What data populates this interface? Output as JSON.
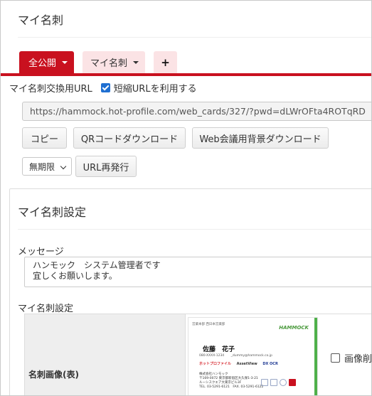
{
  "header": {
    "title": "マイ名刺"
  },
  "tabs": [
    {
      "label": "全公開",
      "has_dropdown": true,
      "active": true
    },
    {
      "label": "マイ名刺",
      "has_dropdown": true,
      "active": false
    },
    {
      "label": "+",
      "icon": "plus-icon"
    }
  ],
  "url_section": {
    "label": "マイ名刺交換用URL",
    "short_url_label": "短縮URLを利用する",
    "short_url_checked": true,
    "url_value": "https://hammock.hot-profile.com/web_cards/327/?pwd=dLWrOFta4ROTqRD"
  },
  "buttons": {
    "copy": "コピー",
    "qr_download": "QRコードダウンロード",
    "web_bg_download": "Web会議用背景ダウンロード",
    "reissue_url": "URL再発行"
  },
  "expiry_select": {
    "selected": "無期限"
  },
  "settings_panel": {
    "title": "マイ名刺設定",
    "message_label": "メッセージ",
    "message_lines": [
      "ハンモック　システム管理者です",
      "宜しくお願いします。"
    ],
    "card_section_label": "マイ名刺設定",
    "card_front_label": "名刺画像(表)",
    "delete_image_label": "画像削除",
    "delete_image_checked": false
  },
  "business_card": {
    "department": "営業本部 西日本営業部",
    "logo": "HAMMOCK",
    "name": "佐藤　花子",
    "phone": "080-XXXX-1234",
    "email": "_dummy@hammock.co.jp",
    "products": [
      "ホットプロファイル",
      "AssetView",
      "DX OCR"
    ],
    "company_name": "株式会社ハンモック",
    "address": "〒169-0072 東京都新宿区大久保1-3-21",
    "building": "ルーシスクエア大東京ビル3F",
    "tel_fax": "TEL. 03-5291-6121　FAX. 03-5291-6122"
  },
  "colors": {
    "brand_red": "#c9111f",
    "tab_pink": "#fbe3e5",
    "checkbox_blue": "#1f6fd1",
    "card_green": "#4eb04a"
  }
}
